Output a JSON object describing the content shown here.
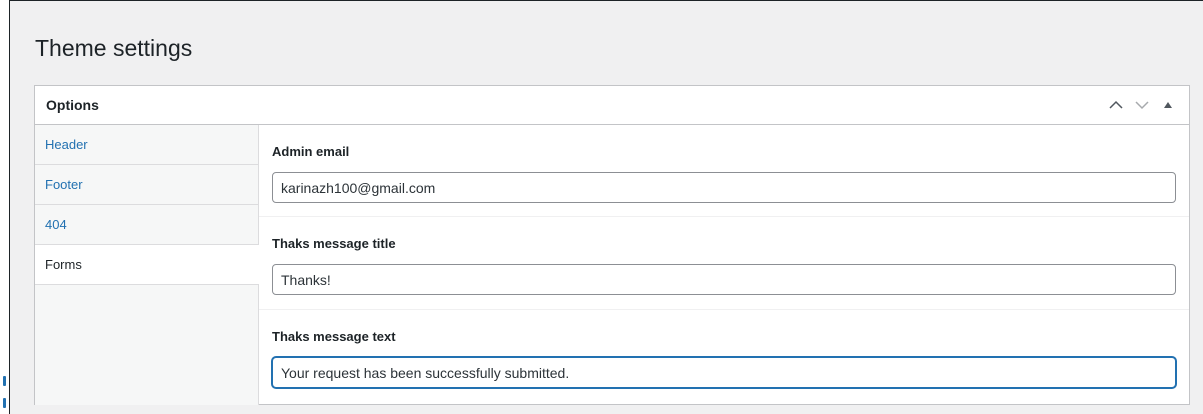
{
  "page": {
    "title": "Theme settings"
  },
  "postbox": {
    "title": "Options",
    "actions": {
      "move_up": "chevron-up-icon",
      "move_down": "chevron-down-icon",
      "toggle": "triangle-up-icon"
    }
  },
  "tabs": [
    {
      "label": "Header",
      "active": false
    },
    {
      "label": "Footer",
      "active": false
    },
    {
      "label": "404",
      "active": false
    },
    {
      "label": "Forms",
      "active": true
    }
  ],
  "fields": {
    "admin_email": {
      "label": "Admin email",
      "value": "karinazh100@gmail.com"
    },
    "thanks_title": {
      "label": "Thaks message title",
      "value": "Thanks!"
    },
    "thanks_text": {
      "label": "Thaks message text",
      "value": "Your request has been successfully submitted."
    }
  },
  "colors": {
    "link": "#2271b1",
    "text": "#1d2327",
    "background": "#f0f0f1",
    "focus": "#2271b1"
  }
}
